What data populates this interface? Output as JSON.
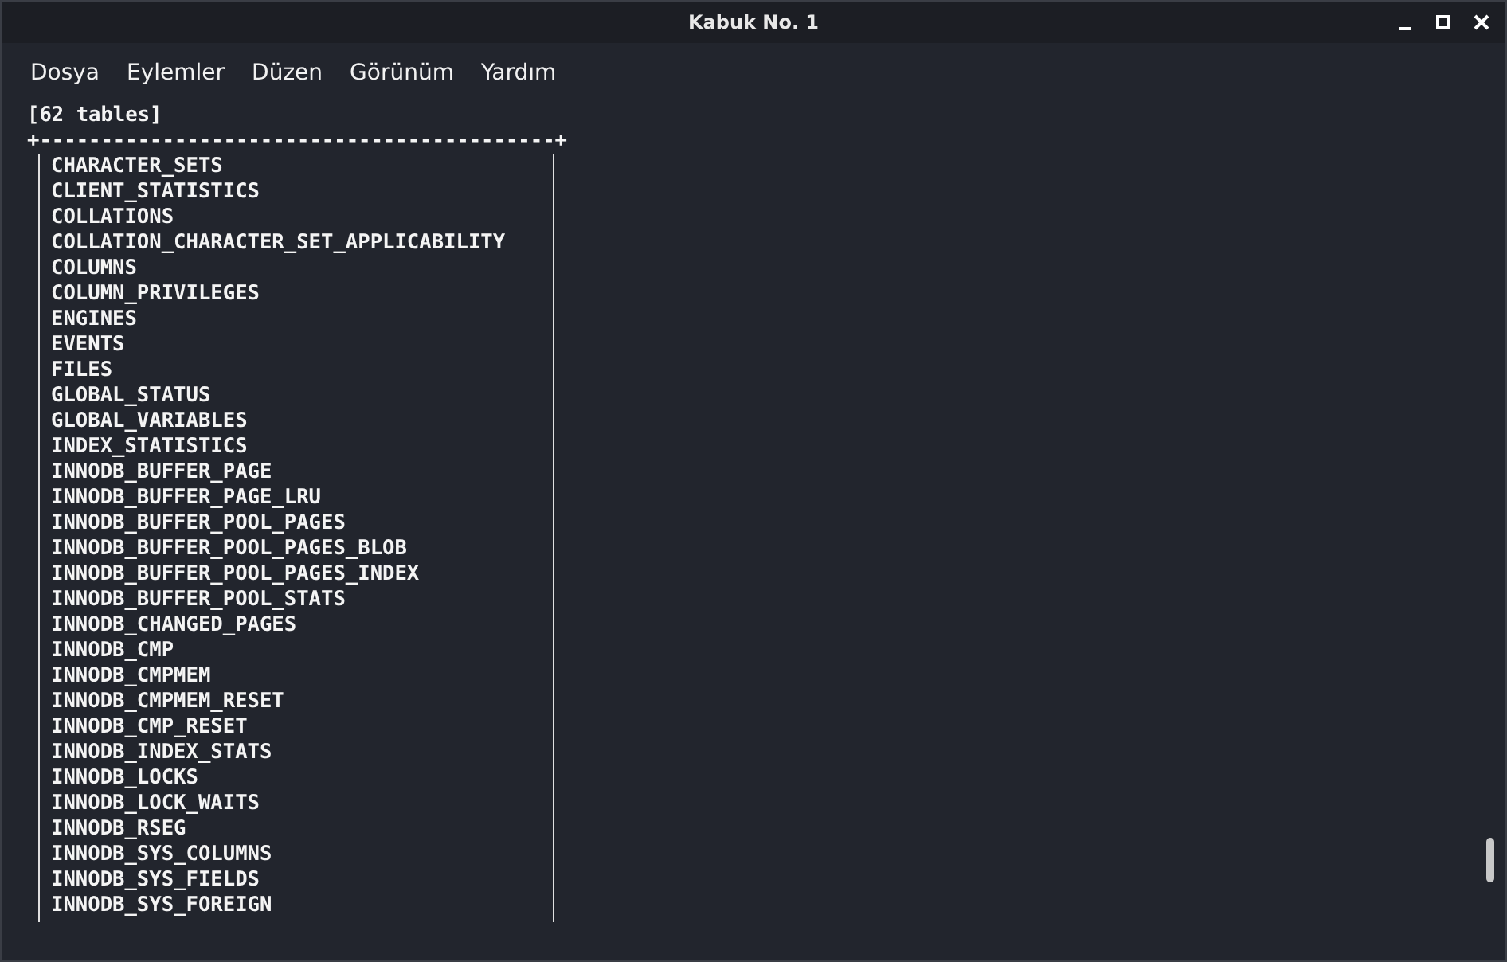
{
  "window": {
    "title": "Kabuk No. 1"
  },
  "menu": [
    "Dosya",
    "Eylemler",
    "Düzen",
    "Görünüm",
    "Yardım"
  ],
  "terminal": {
    "header": "[62 tables]",
    "rule": "+------------------------------------------+",
    "tables": [
      "CHARACTER_SETS",
      "CLIENT_STATISTICS",
      "COLLATIONS",
      "COLLATION_CHARACTER_SET_APPLICABILITY",
      "COLUMNS",
      "COLUMN_PRIVILEGES",
      "ENGINES",
      "EVENTS",
      "FILES",
      "GLOBAL_STATUS",
      "GLOBAL_VARIABLES",
      "INDEX_STATISTICS",
      "INNODB_BUFFER_PAGE",
      "INNODB_BUFFER_PAGE_LRU",
      "INNODB_BUFFER_POOL_PAGES",
      "INNODB_BUFFER_POOL_PAGES_BLOB",
      "INNODB_BUFFER_POOL_PAGES_INDEX",
      "INNODB_BUFFER_POOL_STATS",
      "INNODB_CHANGED_PAGES",
      "INNODB_CMP",
      "INNODB_CMPMEM",
      "INNODB_CMPMEM_RESET",
      "INNODB_CMP_RESET",
      "INNODB_INDEX_STATS",
      "INNODB_LOCKS",
      "INNODB_LOCK_WAITS",
      "INNODB_RSEG",
      "INNODB_SYS_COLUMNS",
      "INNODB_SYS_FIELDS",
      "INNODB_SYS_FOREIGN"
    ]
  }
}
